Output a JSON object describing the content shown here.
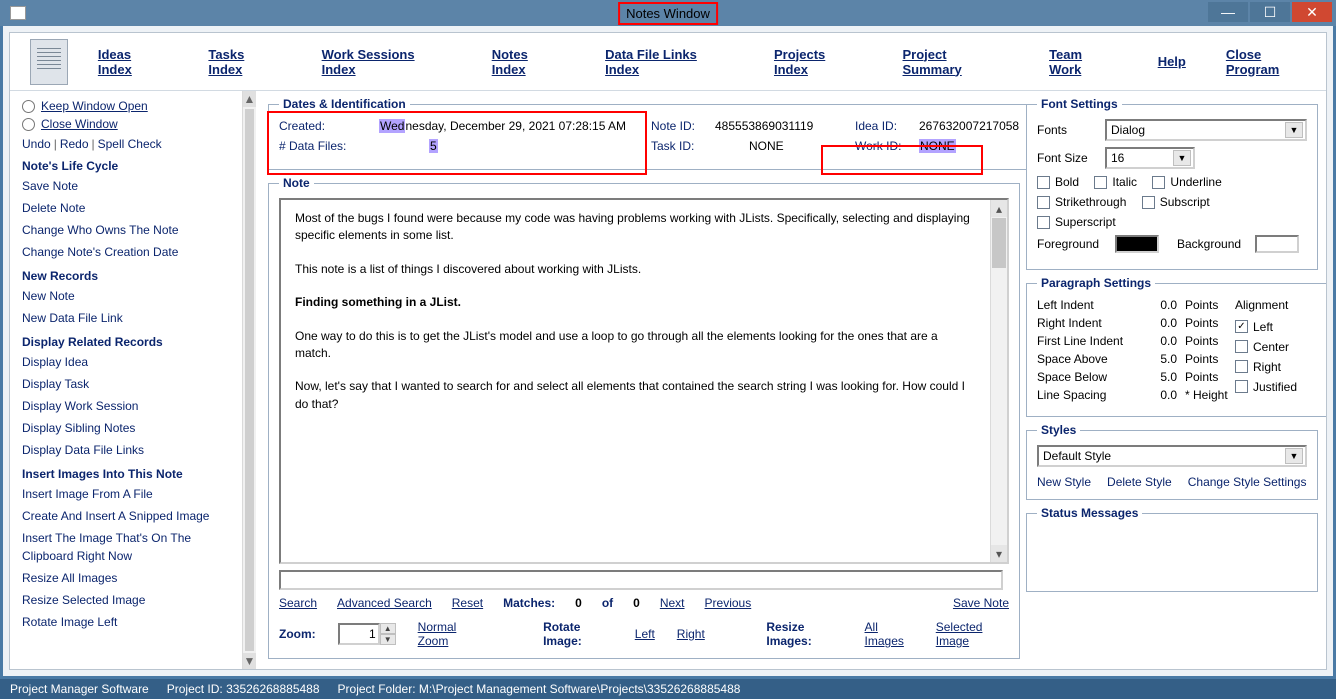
{
  "window": {
    "title": "Notes Window"
  },
  "nav": {
    "ideas": "Ideas Index",
    "tasks": "Tasks Index",
    "works": "Work Sessions Index",
    "notes": "Notes Index",
    "datafiles": "Data File Links Index",
    "projects": "Projects Index",
    "summary": "Project Summary",
    "team": "Team Work",
    "help": "Help",
    "close": "Close Program"
  },
  "sidebar": {
    "keep_open": "Keep Window Open",
    "close_win": "Close Window",
    "undo": "Undo",
    "redo": "Redo",
    "spell": "Spell Check",
    "life_head": "Note's Life Cycle",
    "save_note": "Save Note",
    "delete_note": "Delete Note",
    "change_owner": "Change Who Owns The Note",
    "change_date": "Change Note's Creation Date",
    "new_head": "New Records",
    "new_note": "New Note",
    "new_dfl": "New Data File Link",
    "disp_head": "Display Related Records",
    "disp_idea": "Display Idea",
    "disp_task": "Display Task",
    "disp_ws": "Display Work Session",
    "disp_sib": "Display Sibling Notes",
    "disp_dfl": "Display Data File Links",
    "ins_head": "Insert Images Into This Note",
    "ins_file": "Insert Image From A File",
    "ins_snip": "Create And Insert A Snipped Image",
    "ins_clip": "Insert The Image That's On The Clipboard Right Now",
    "resize_all": "Resize All Images",
    "resize_sel": "Resize Selected Image",
    "rotate_left": "Rotate Image Left"
  },
  "dates": {
    "legend": "Dates & Identification",
    "created_lbl": "Created:",
    "created_hl": "Wed",
    "created_rest": "nesday, December 29, 2021   07:28:15 AM",
    "df_lbl": "# Data Files:",
    "df_val": "5",
    "noteid_lbl": "Note ID:",
    "noteid": "485553869031119",
    "ideaid_lbl": "Idea ID:",
    "ideaid": "267632007217058",
    "taskid_lbl": "Task ID:",
    "taskid": "NONE",
    "workid_lbl": "Work ID:",
    "workid": "NONE"
  },
  "note": {
    "legend": "Note",
    "p1": "Most of the bugs I found were because my code was having problems working with JLists. Specifically, selecting and displaying specific elements in some list.",
    "p2": "This note is a list of things I discovered about working with JLists.",
    "h1": "Finding something in a JList.",
    "p3": "One way to do this is to get the JList's model and use a loop to go through all the elements looking for the ones that are a match.",
    "p4": "Now, let's say that I wanted to search for and select all elements that contained the search string I was looking for. How could I do that?"
  },
  "search": {
    "search": "Search",
    "adv": "Advanced Search",
    "reset": "Reset",
    "matches_lbl": "Matches:",
    "matches": "0",
    "of": "of",
    "total": "0",
    "next": "Next",
    "prev": "Previous",
    "save": "Save Note"
  },
  "zoom": {
    "label": "Zoom:",
    "value": "1",
    "normal": "Normal Zoom",
    "rotate_lbl": "Rotate Image:",
    "left": "Left",
    "right": "Right",
    "resize_lbl": "Resize Images:",
    "all": "All Images",
    "sel": "Selected Image"
  },
  "right": {
    "fonts_legend": "Font Settings",
    "fonts_lbl": "Fonts",
    "font_name": "Dialog",
    "fontsize_lbl": "Font Size",
    "font_size": "16",
    "bold": "Bold",
    "italic": "Italic",
    "underline": "Underline",
    "strike": "Strikethrough",
    "sub": "Subscript",
    "super": "Superscript",
    "fg_lbl": "Foreground",
    "bg_lbl": "Background",
    "para_legend": "Paragraph Settings",
    "li": "Left Indent",
    "ri": "Right Indent",
    "fli": "First Line Indent",
    "sa": "Space Above",
    "sb": "Space Below",
    "ls": "Line Spacing",
    "li_v": "0.0",
    "ri_v": "0.0",
    "fli_v": "0.0",
    "sa_v": "5.0",
    "sb_v": "5.0",
    "ls_v": "0.0",
    "points": "Points",
    "height": "* Height",
    "align_lbl": "Alignment",
    "al_left": "Left",
    "al_center": "Center",
    "al_right": "Right",
    "al_just": "Justified",
    "styles_legend": "Styles",
    "style_default": "Default Style",
    "new_style": "New Style",
    "del_style": "Delete Style",
    "chg_style": "Change Style Settings",
    "status_legend": "Status Messages"
  },
  "status": {
    "app": "Project Manager Software",
    "pid_lbl": "Project ID: ",
    "pid": "33526268885488",
    "pf_lbl": "Project Folder: ",
    "pf": "M:\\Project Management Software\\Projects\\33526268885488"
  }
}
